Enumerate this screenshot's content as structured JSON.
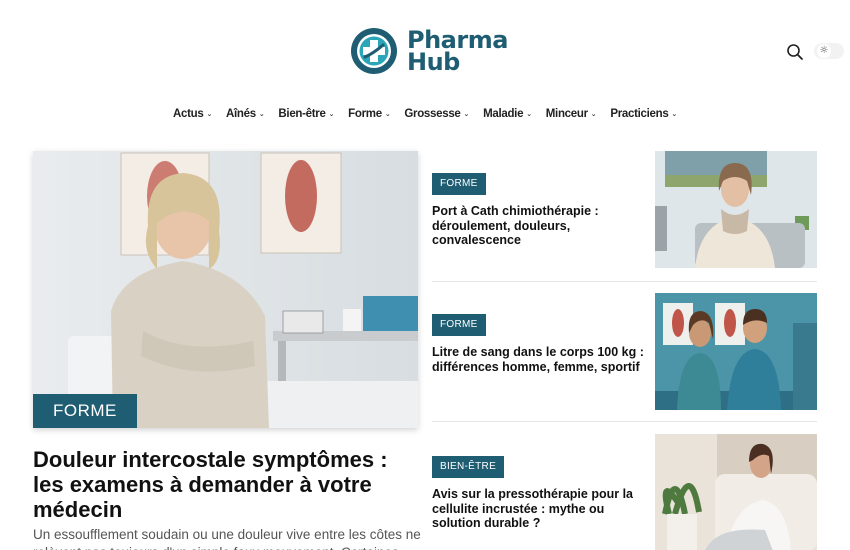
{
  "header": {
    "logo_line1": "Pharma",
    "logo_line2": "Hub",
    "theme_toggle_glyph": "☼"
  },
  "nav": {
    "items": [
      {
        "label": "Actus"
      },
      {
        "label": "Aînés"
      },
      {
        "label": "Bien-être"
      },
      {
        "label": "Forme"
      },
      {
        "label": "Grossesse"
      },
      {
        "label": "Maladie"
      },
      {
        "label": "Minceur"
      },
      {
        "label": "Practiciens"
      }
    ],
    "chevron_glyph": "⌄"
  },
  "featured": {
    "category": "FORME",
    "title": "Douleur intercostale symptômes : les examens à demander à votre médecin",
    "excerpt": "Un essoufflement soudain ou une douleur vive entre les côtes ne relèvent pas toujours d'un simple faux mouvement. Certaines"
  },
  "side": {
    "items": [
      {
        "category": "FORME",
        "title": "Port à Cath chimiothérapie : déroulement, douleurs, convalescence"
      },
      {
        "category": "FORME",
        "title": "Litre de sang dans le corps 100 kg : différences homme, femme, sportif"
      },
      {
        "category": "BIEN-ÊTRE",
        "title": "Avis sur la pressothérapie pour la cellulite incrustée : mythe ou solution durable ?"
      }
    ]
  },
  "colors": {
    "brand": "#1f5d73",
    "brand_light": "#2aa6b8"
  }
}
